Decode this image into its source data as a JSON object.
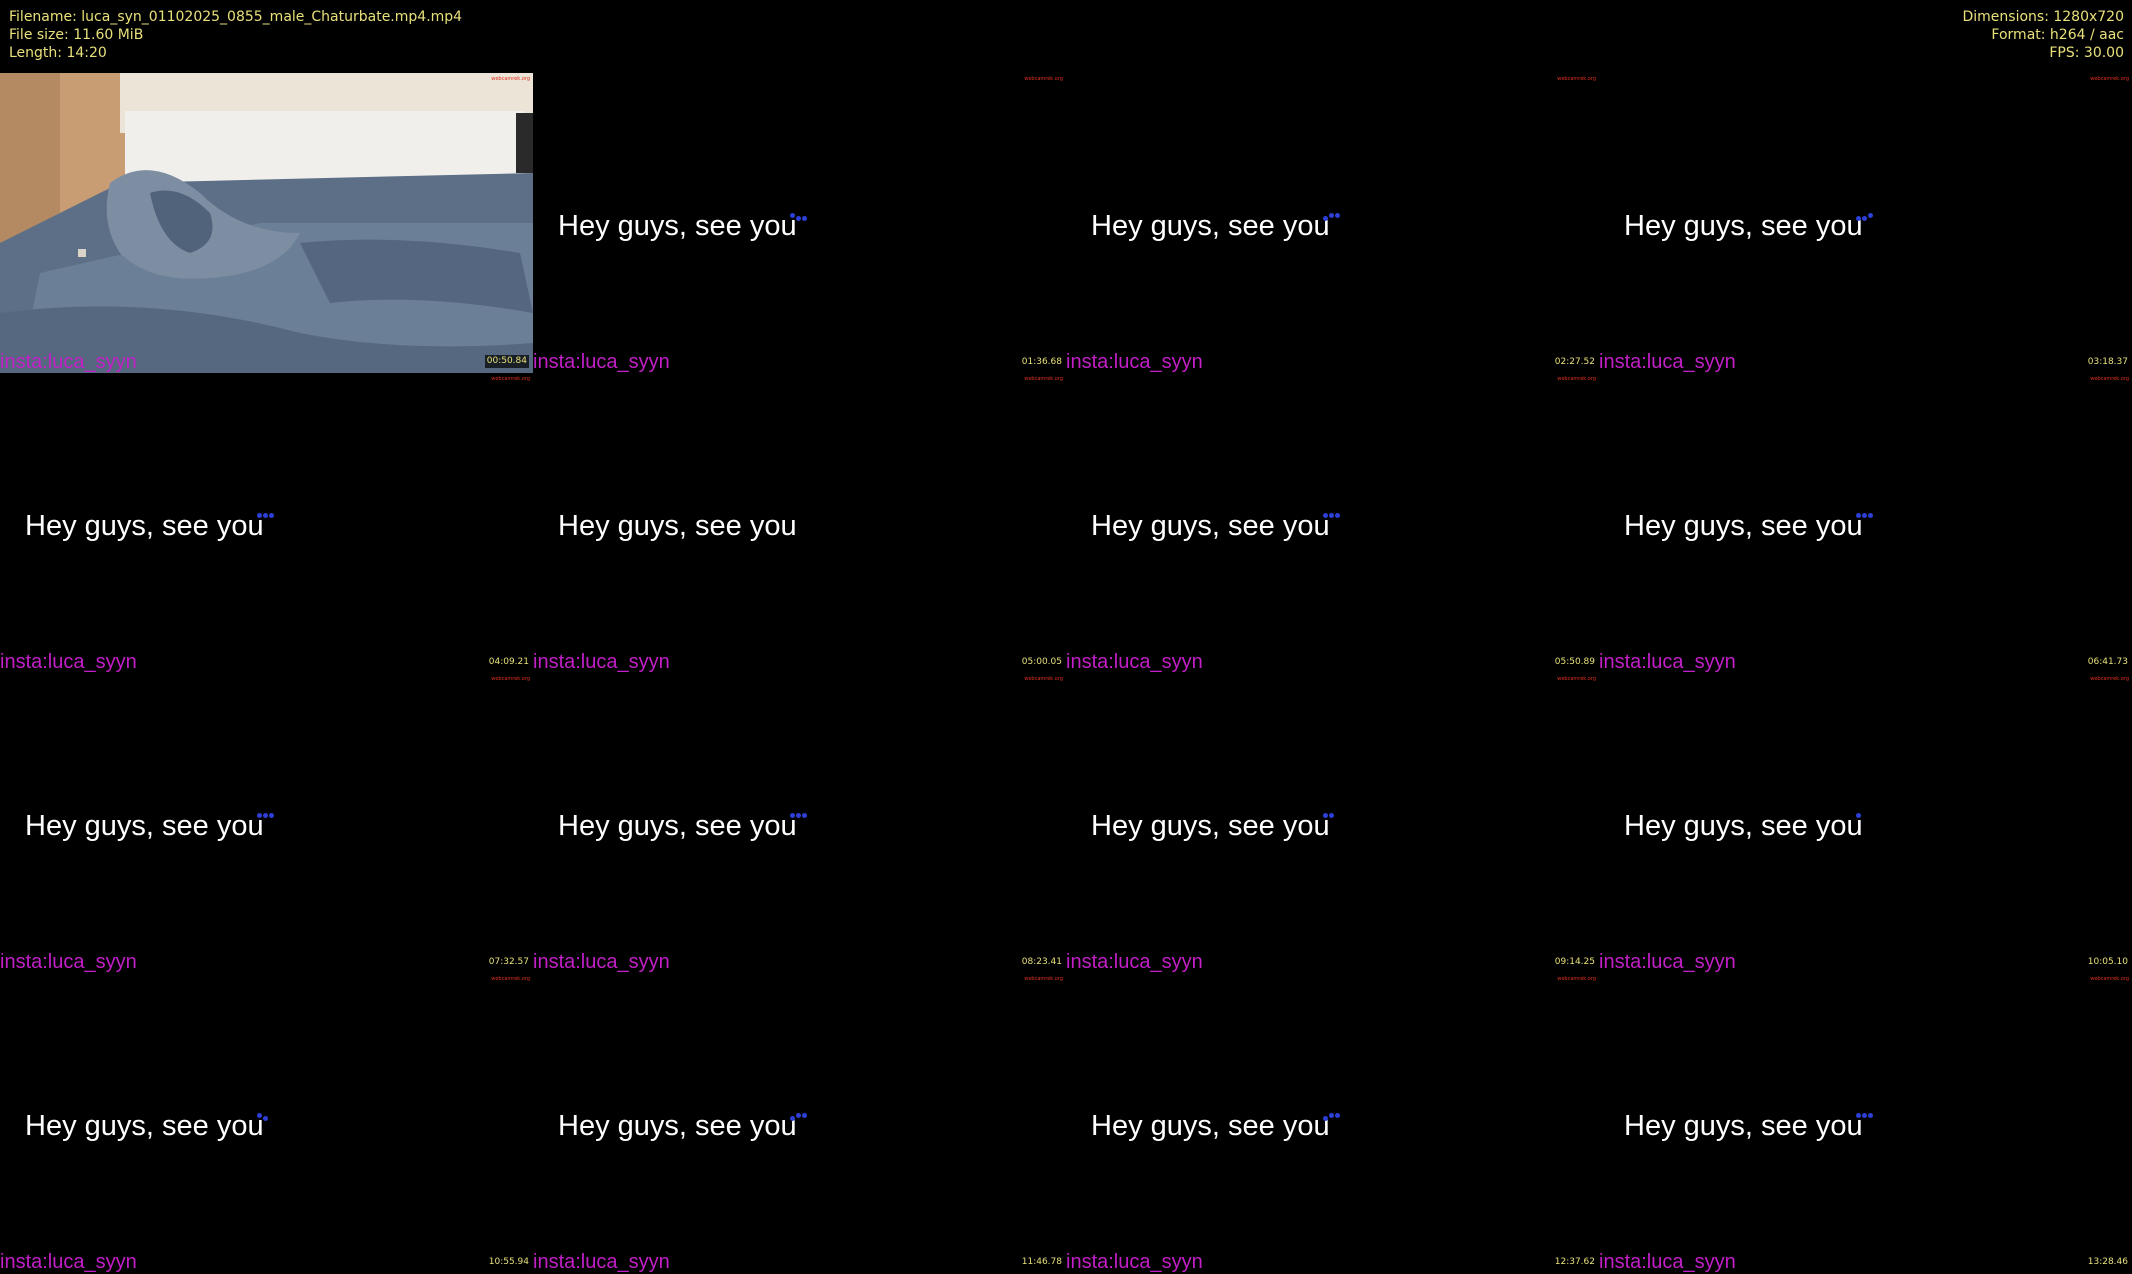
{
  "header": {
    "filename": "Filename: luca_syn_01102025_0855_male_Chaturbate.mp4.mp4",
    "file_size": "File size: 11.60 MiB",
    "length": "Length: 14:20",
    "dimensions": "Dimensions: 1280x720",
    "format": "Format: h264 / aac",
    "fps": "FPS: 30.00"
  },
  "thumbnails": {
    "watermark": "webcamrek.org",
    "caption": "Hey guys, see you",
    "handle": "insta:luca_syyn",
    "timestamps": [
      "00:50.84",
      "01:36.68",
      "02:27.52",
      "03:18.37",
      "04:09.21",
      "05:00.05",
      "05:50.89",
      "06:41.73",
      "07:32.57",
      "08:23.41",
      "09:14.25",
      "10:05.10",
      "10:55.94",
      "11:46.78",
      "12:37.62",
      "13:28.46"
    ]
  },
  "colors": {
    "meta_text": "#e8e07a",
    "handle": "#c21fc7",
    "caption": "#ffffff",
    "watermark": "#e0301e",
    "dots": "#2d3fd6"
  }
}
